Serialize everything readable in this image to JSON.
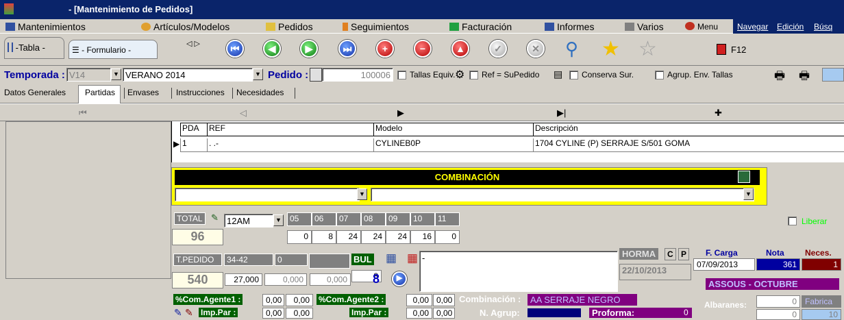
{
  "window": {
    "title": "- [Mantenimiento de Pedidos]"
  },
  "menu": {
    "mantenimientos": "Mantenimientos",
    "articulos": "Artículos/Modelos",
    "pedidos": "Pedidos",
    "seguimientos": "Seguimientos",
    "facturacion": "Facturación",
    "informes": "Informes",
    "varios": "Varios",
    "menu": "Menu",
    "navegar": "Navegar",
    "edicion": "Edición",
    "busq": "Búsq"
  },
  "toolbar": {
    "tab_tabla": "-Tabla -",
    "tab_formulario": "- Formulario -",
    "arrows": "◁ ▷",
    "f12": "F12"
  },
  "row3": {
    "temporada_label": "Temporada :",
    "temporada_code": "V14",
    "temporada_name": "VERANO 2014",
    "pedido_label": "Pedido :",
    "pedido_num": "100006",
    "tallas_equiv": "Tallas Equiv.",
    "ref_supedido": "Ref = SuPedido",
    "conserva_sur": "Conserva Sur.",
    "agrup_env_tallas": "Agrup. Env. Tallas"
  },
  "tabs": [
    "Datos Generales",
    "Partidas",
    "Envases",
    "Instrucciones",
    "Necesidades"
  ],
  "nav": {
    "first": "⏮",
    "prev": "◁",
    "next": "▶",
    "last": "▶|",
    "add": "✚"
  },
  "grid": {
    "headers": {
      "pda": "PDA",
      "ref": "REF",
      "modelo": "Modelo",
      "descripcion": "Descripción"
    },
    "row": {
      "pda": "1",
      "ref": ". .-",
      "modelo": "CYLINEB0P",
      "descripcion": "1704 CYLINE (P) SERRAJE S/501 GOMA"
    }
  },
  "combinacion": {
    "title": "COMBINACIÓN"
  },
  "sizes": {
    "total_label": "TOTAL",
    "unit": "12AM",
    "headers": [
      "05",
      "06",
      "07",
      "08",
      "09",
      "10",
      "11"
    ],
    "values": [
      "0",
      "8",
      "24",
      "24",
      "24",
      "16",
      "0"
    ],
    "total": "96",
    "liberar": "Liberar"
  },
  "pedido": {
    "label": "T.PEDIDO",
    "range": "34-42",
    "zero": "0",
    "total": "540",
    "price": "27,000",
    "v2": "0,000",
    "v3": "0,000",
    "bul_label": "BUL",
    "bul_value": "8",
    "bul_big": "8",
    "note": "-",
    "horma": "HORMA",
    "c": "C",
    "p": "P",
    "horma_date": "22/10/2013",
    "f_carga_label": "F. Carga",
    "f_carga": "07/09/2013",
    "nota_label": "Nota",
    "nota": "361",
    "neces_label": "Neces.",
    "neces": "1",
    "assous": "ASSOUS - OCTUBRE"
  },
  "bottom": {
    "com_agente1": "%Com.Agente1 :",
    "a1v1": "0,00",
    "a1v2": "0,00",
    "com_agente2": "%Com.Agente2 :",
    "a2v1": "0,00",
    "a2v2": "0,00",
    "combinacion_label": "Combinación :",
    "combinacion_value": "AA SERRAJE NEGRO",
    "albaranes_label": "Albaranes:",
    "albaranes": "0",
    "fabrica": "Fabrica",
    "imp_par1": "Imp.Par :",
    "ip1v1": "0,00",
    "ip1v2": "0,00",
    "imp_par2": "Imp.Par :",
    "ip2v1": "0,00",
    "ip2v2": "0,00",
    "n_agrup": "N. Agrup:",
    "proforma": "Proforma:",
    "proforma_v": "0",
    "alb2": "0",
    "fab2": "10"
  }
}
